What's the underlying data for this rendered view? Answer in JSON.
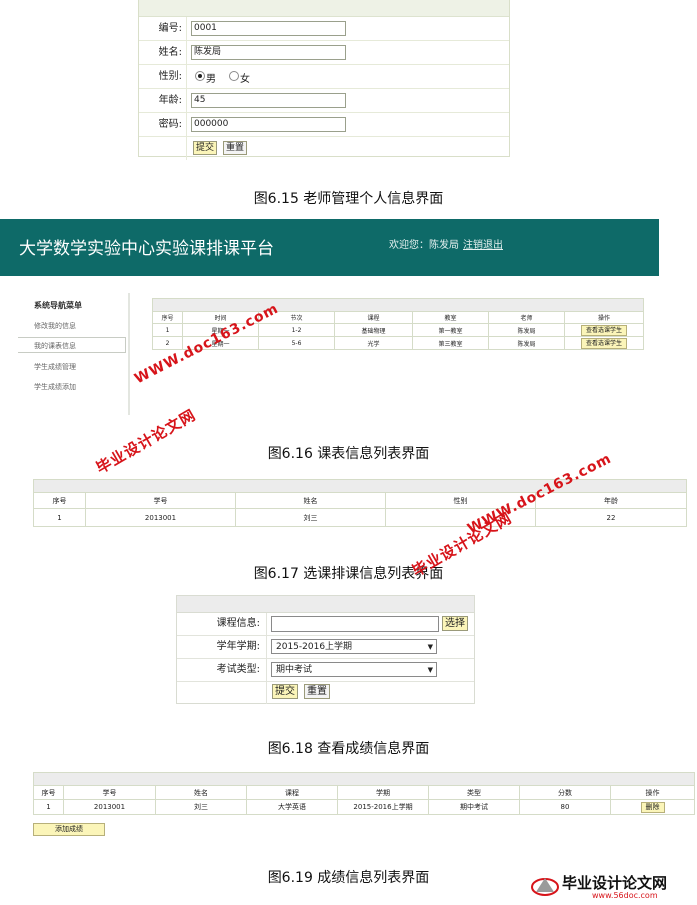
{
  "fig615": {
    "caption": "图6.15  老师管理个人信息界面",
    "labels": {
      "id": "编号:",
      "name": "姓名:",
      "gender": "性别:",
      "age": "年龄:",
      "password": "密码:"
    },
    "values": {
      "id": "0001",
      "name": "陈发局",
      "age": "45",
      "password": "000000"
    },
    "gender_options": [
      "男",
      "女"
    ],
    "gender_selected": "男",
    "submit": "提交",
    "reset": "重置"
  },
  "fig616": {
    "caption": "图6.16  课表信息列表界面",
    "app_title": "大学数学实验中心实验课排课平台",
    "welcome": "欢迎您：陈发局",
    "logout": "注销退出",
    "menu_title": "系统导航菜单",
    "menu_items": [
      "修改我的信息",
      "我的课表信息",
      "学生成绩管理",
      "学生成绩添加"
    ],
    "columns": [
      "序号",
      "时间",
      "节次",
      "课程",
      "教室",
      "老师",
      "操作"
    ],
    "rows": [
      [
        "1",
        "星期一",
        "1-2",
        "基础物理",
        "第一教室",
        "陈发局",
        "查看选课学生"
      ],
      [
        "2",
        "星期一",
        "5-6",
        "光学",
        "第三教室",
        "陈发局",
        "查看选课学生"
      ]
    ]
  },
  "fig617": {
    "caption": "图6.17  选课排课信息列表界面",
    "columns": [
      "序号",
      "学号",
      "姓名",
      "性别",
      "年龄"
    ],
    "rows": [
      [
        "1",
        "2013001",
        "刘三",
        "",
        "22"
      ]
    ]
  },
  "fig618": {
    "caption": "图6.18  查看成绩信息界面",
    "labels": {
      "course": "课程信息:",
      "term": "学年学期:",
      "exam": "考试类型:"
    },
    "select_btn": "选择",
    "term_value": "2015-2016上学期",
    "exam_value": "期中考试",
    "submit": "提交",
    "reset": "重置"
  },
  "fig619": {
    "caption": "图6.19  成绩信息列表界面",
    "columns": [
      "序号",
      "学号",
      "姓名",
      "课程",
      "学期",
      "类型",
      "分数",
      "操作"
    ],
    "rows": [
      [
        "1",
        "2013001",
        "刘三",
        "大学英语",
        "2015-2016上学期",
        "期中考试",
        "80",
        "删除"
      ]
    ],
    "add_btn": "添加成绩"
  },
  "watermarks": {
    "url": "WWW.doc163.com",
    "brand": "毕业设计论文网",
    "logo_text": "毕业设计论文网",
    "logo_url": "www.56doc.com"
  },
  "colors": {
    "banner": "#0e6a68",
    "button_yellow": "#fbf5b9",
    "watermark_red": "#d7141a"
  }
}
